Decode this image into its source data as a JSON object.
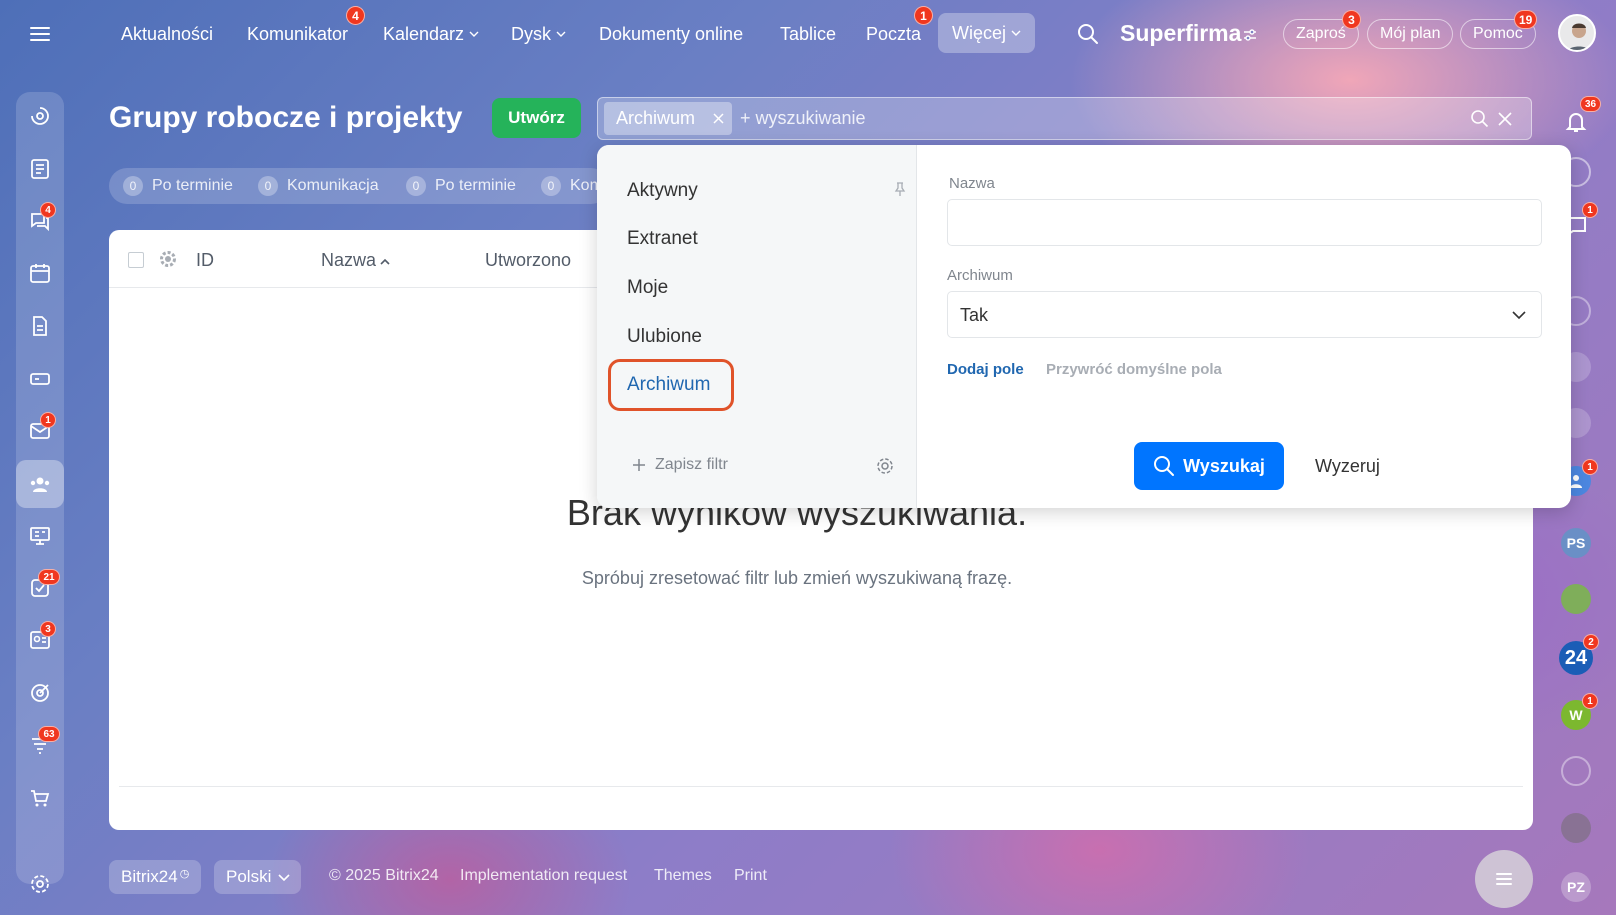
{
  "colors": {
    "accent": "#0075ff",
    "create": "#25b35a",
    "badge": "#f0371f",
    "highlight_ring": "#e0532a",
    "link": "#2067b0"
  },
  "topnav": {
    "items": [
      {
        "label": "Aktualności",
        "badge": ""
      },
      {
        "label": "Komunikator",
        "badge": "4"
      },
      {
        "label": "Kalendarz",
        "badge": ""
      },
      {
        "label": "Dysk",
        "badge": ""
      },
      {
        "label": "Dokumenty online",
        "badge": ""
      },
      {
        "label": "Tablice",
        "badge": ""
      },
      {
        "label": "Poczta",
        "badge": "1"
      },
      {
        "label": "Więcej",
        "badge": ""
      }
    ],
    "brand": "Superfirma",
    "invite": {
      "label": "Zaproś",
      "badge": "3"
    },
    "plan": "Mój plan",
    "help": {
      "label": "Pomoc",
      "badge": "19"
    },
    "notifications_badge": "36"
  },
  "sidebar_badges": {
    "messenger": "4",
    "mail": "1",
    "tasks": "21",
    "crm": "3",
    "funnel": "63"
  },
  "right_strip": {
    "chat_badge": "1",
    "group_badge": "1",
    "ps": "PS",
    "b24": "24",
    "b24_badge": "2",
    "w": "W",
    "w_badge": "1",
    "pz": "PZ"
  },
  "page": {
    "title": "Grupy robocze i projekty",
    "create_label": "Utwórz"
  },
  "search": {
    "chip": "Archiwum",
    "placeholder": "+ wyszukiwanie"
  },
  "counters": [
    {
      "count": "0",
      "label": "Po terminie"
    },
    {
      "count": "0",
      "label": "Komunikacja"
    },
    {
      "count": "0",
      "label": "Po terminie"
    },
    {
      "count": "0",
      "label": "Kom"
    }
  ],
  "table": {
    "col_id": "ID",
    "col_name": "Nazwa",
    "col_created": "Utworzono"
  },
  "empty": {
    "title": "Brak wyników wyszukiwania.",
    "subtitle": "Spróbuj zresetować filtr lub zmień wyszukiwaną frazę."
  },
  "filter": {
    "presets": [
      "Aktywny",
      "Extranet",
      "Moje",
      "Ulubione",
      "Archiwum"
    ],
    "save_filter": "Zapisz filtr",
    "name_label": "Nazwa",
    "name_value": "",
    "archive_label": "Archiwum",
    "archive_value": "Tak",
    "add_field": "Dodaj pole",
    "restore_fields": "Przywróć domyślne pola",
    "search_button": "Wyszukaj",
    "reset_button": "Wyzeruj"
  },
  "footer": {
    "bitrix": "Bitrix24",
    "language": "Polski",
    "copyright": "© 2025 Bitrix24",
    "implementation": "Implementation request",
    "themes": "Themes",
    "print": "Print"
  }
}
